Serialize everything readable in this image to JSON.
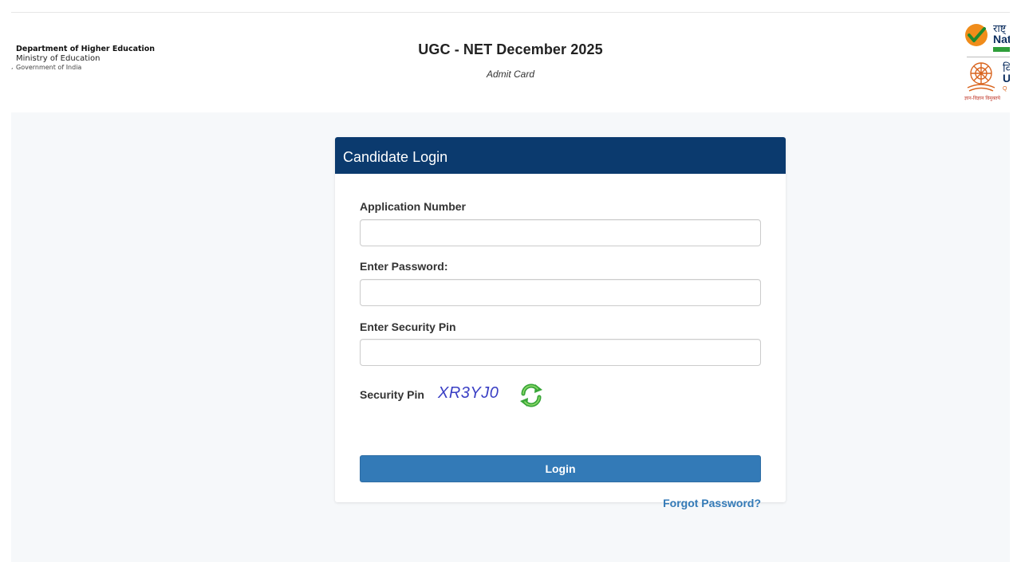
{
  "header": {
    "dept_line1": "Department of Higher Education",
    "dept_line2": "Ministry of Education",
    "dept_line3": "Government of India",
    "title": "UGC - NET December 2025",
    "subtitle": "Admit Card",
    "logo_nirf_line1": "राष्ट्",
    "logo_nirf_line2": "Nat",
    "logo_ugc_line1": "वि",
    "logo_ugc_line2": "U",
    "logo_ugc_line3": "Q",
    "logo_ugc_hindi": "ज्ञान-विज्ञान विमुक्तये"
  },
  "login": {
    "heading": "Candidate Login",
    "application_number_label": "Application Number",
    "application_number_value": "",
    "password_label": "Enter Password:",
    "password_value": "",
    "security_pin_input_label": "Enter Security Pin",
    "security_pin_input_value": "",
    "security_pin_label": "Security Pin",
    "security_pin_code": "XR3YJ0",
    "login_button": "Login",
    "forgot_password": "Forgot Password?"
  },
  "icons": {
    "refresh": "refresh-captcha-icon",
    "nirf_check": "check-circle-icon",
    "ugc_emblem": "ugc-emblem-icon"
  },
  "colors": {
    "card_header": "#0b3a6e",
    "button": "#337ab7",
    "link": "#337ab7",
    "captcha_text": "#3a3fc4",
    "refresh_icon": "#3aa63a"
  }
}
